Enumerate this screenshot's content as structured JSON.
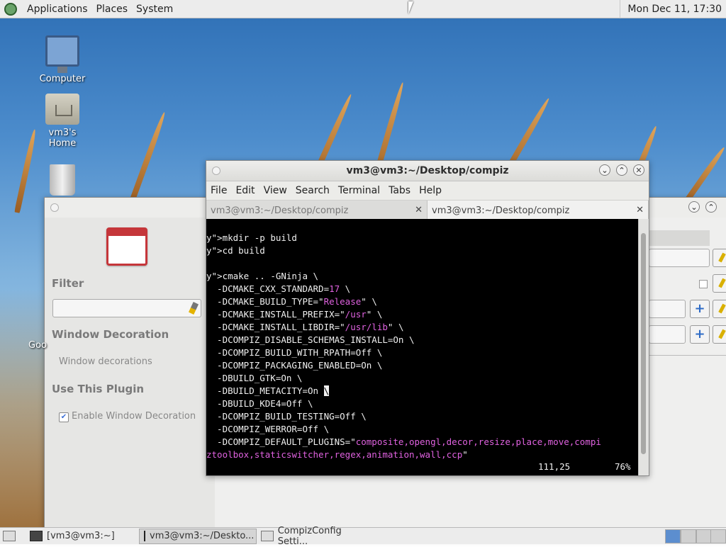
{
  "top_panel": {
    "menus": [
      "Applications",
      "Places",
      "System"
    ],
    "clock": "Mon Dec 11, 17:30"
  },
  "desktop_icons": [
    {
      "label": "Computer",
      "icon": "computer-icon"
    },
    {
      "label": "vm3's Home",
      "icon": "home-folder-icon"
    },
    {
      "label": "",
      "icon": "trash-icon"
    }
  ],
  "ccsm": {
    "filter_title": "Filter",
    "window_decoration_title": "Window Decoration",
    "window_decorations_item": "Window decorations",
    "use_plugin_title": "Use This Plugin",
    "enable_label": "Enable Window Decoration",
    "enable_checked": true,
    "partial_text": "Goo"
  },
  "terminal": {
    "title": "vm3@vm3:~/Desktop/compiz",
    "menus": [
      "File",
      "Edit",
      "View",
      "Search",
      "Terminal",
      "Tabs",
      "Help"
    ],
    "tabs": [
      {
        "label": "vm3@vm3:~/Desktop/compiz",
        "active": false
      },
      {
        "label": "vm3@vm3:~/Desktop/compiz",
        "active": true
      }
    ],
    "lines": [
      "",
      "mkdir -p build",
      "cd build",
      "",
      "cmake .. -GNinja \\",
      "  -DCMAKE_CXX_STANDARD=17 \\",
      "  -DCMAKE_BUILD_TYPE=\"Release\" \\",
      "  -DCMAKE_INSTALL_PREFIX=\"/usr\" \\",
      "  -DCMAKE_INSTALL_LIBDIR=\"/usr/lib\" \\",
      "  -DCOMPIZ_DISABLE_SCHEMAS_INSTALL=On \\",
      "  -DCOMPIZ_BUILD_WITH_RPATH=Off \\",
      "  -DCOMPIZ_PACKAGING_ENABLED=On \\",
      "  -DBUILD_GTK=On \\",
      "  -DBUILD_METACITY=On \\",
      "  -DBUILD_KDE4=Off \\",
      "  -DCOMPIZ_BUILD_TESTING=Off \\",
      "  -DCOMPIZ_WERROR=Off \\",
      "  -DCOMPIZ_DEFAULT_PLUGINS=\"composite,opengl,decor,resize,place,move,compi",
      "ztoolbox,staticswitcher,regex,animation,wall,ccp\""
    ],
    "position": "111,25",
    "percent": "76%"
  },
  "taskbar": {
    "items": [
      {
        "label": "[vm3@vm3:~]",
        "current": false
      },
      {
        "label": "vm3@vm3:~/Deskto...",
        "current": true
      },
      {
        "label": "CompizConfig Setti...",
        "current": false
      }
    ]
  },
  "colors": {
    "syntax_yellow": "#e5e56b",
    "syntax_magenta": "#e062e0",
    "terminal_bg": "#000000"
  }
}
